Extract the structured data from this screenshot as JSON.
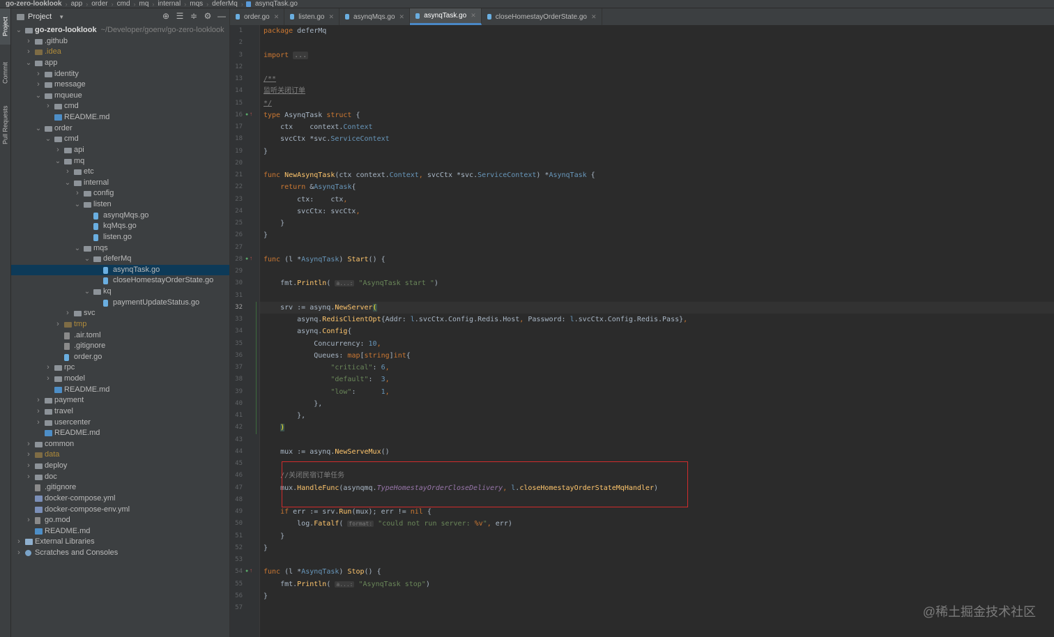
{
  "breadcrumb": [
    "go-zero-looklook",
    "app",
    "order",
    "cmd",
    "mq",
    "internal",
    "mqs",
    "deferMq",
    "asynqTask.go"
  ],
  "tool_windows": {
    "project": "Project",
    "commit": "Commit",
    "pull_requests": "Pull Requests"
  },
  "project_panel": {
    "title": "Project"
  },
  "tree": [
    {
      "depth": 0,
      "chevron": "▾",
      "icon": "folder",
      "label": "go-zero-looklook",
      "path": "~/Developer/goenv/go-zero-looklook",
      "bold": true
    },
    {
      "depth": 1,
      "chevron": "›",
      "icon": "folder",
      "label": ".github"
    },
    {
      "depth": 1,
      "chevron": "›",
      "icon": "folder-ex",
      "label": ".idea",
      "excluded": true
    },
    {
      "depth": 1,
      "chevron": "▾",
      "icon": "folder",
      "label": "app"
    },
    {
      "depth": 2,
      "chevron": "›",
      "icon": "folder",
      "label": "identity"
    },
    {
      "depth": 2,
      "chevron": "›",
      "icon": "folder",
      "label": "message"
    },
    {
      "depth": 2,
      "chevron": "▾",
      "icon": "folder",
      "label": "mqueue"
    },
    {
      "depth": 3,
      "chevron": "›",
      "icon": "folder",
      "label": "cmd"
    },
    {
      "depth": 3,
      "chevron": "",
      "icon": "md",
      "label": "README.md"
    },
    {
      "depth": 2,
      "chevron": "▾",
      "icon": "folder",
      "label": "order"
    },
    {
      "depth": 3,
      "chevron": "▾",
      "icon": "folder",
      "label": "cmd"
    },
    {
      "depth": 4,
      "chevron": "›",
      "icon": "folder",
      "label": "api"
    },
    {
      "depth": 4,
      "chevron": "▾",
      "icon": "folder",
      "label": "mq"
    },
    {
      "depth": 5,
      "chevron": "›",
      "icon": "folder",
      "label": "etc"
    },
    {
      "depth": 5,
      "chevron": "▾",
      "icon": "folder",
      "label": "internal"
    },
    {
      "depth": 6,
      "chevron": "›",
      "icon": "folder",
      "label": "config"
    },
    {
      "depth": 6,
      "chevron": "▾",
      "icon": "folder",
      "label": "listen"
    },
    {
      "depth": 7,
      "chevron": "",
      "icon": "gofile",
      "label": "asynqMqs.go"
    },
    {
      "depth": 7,
      "chevron": "",
      "icon": "gofile",
      "label": "kqMqs.go"
    },
    {
      "depth": 7,
      "chevron": "",
      "icon": "gofile",
      "label": "listen.go"
    },
    {
      "depth": 6,
      "chevron": "▾",
      "icon": "folder",
      "label": "mqs"
    },
    {
      "depth": 7,
      "chevron": "▾",
      "icon": "folder",
      "label": "deferMq"
    },
    {
      "depth": 8,
      "chevron": "",
      "icon": "gofile",
      "label": "asynqTask.go",
      "selected": true
    },
    {
      "depth": 8,
      "chevron": "",
      "icon": "gofile",
      "label": "closeHomestayOrderState.go"
    },
    {
      "depth": 7,
      "chevron": "▾",
      "icon": "folder",
      "label": "kq"
    },
    {
      "depth": 8,
      "chevron": "",
      "icon": "gofile",
      "label": "paymentUpdateStatus.go"
    },
    {
      "depth": 5,
      "chevron": "›",
      "icon": "folder",
      "label": "svc"
    },
    {
      "depth": 4,
      "chevron": "›",
      "icon": "folder-ex",
      "label": "tmp",
      "excluded": true
    },
    {
      "depth": 4,
      "chevron": "",
      "icon": "cfg",
      "label": ".air.toml"
    },
    {
      "depth": 4,
      "chevron": "",
      "icon": "cfg",
      "label": ".gitignore"
    },
    {
      "depth": 4,
      "chevron": "",
      "icon": "gofile",
      "label": "order.go"
    },
    {
      "depth": 3,
      "chevron": "›",
      "icon": "folder",
      "label": "rpc"
    },
    {
      "depth": 3,
      "chevron": "›",
      "icon": "folder",
      "label": "model"
    },
    {
      "depth": 3,
      "chevron": "",
      "icon": "md",
      "label": "README.md"
    },
    {
      "depth": 2,
      "chevron": "›",
      "icon": "folder",
      "label": "payment"
    },
    {
      "depth": 2,
      "chevron": "›",
      "icon": "folder",
      "label": "travel"
    },
    {
      "depth": 2,
      "chevron": "›",
      "icon": "folder",
      "label": "usercenter"
    },
    {
      "depth": 2,
      "chevron": "",
      "icon": "md",
      "label": "README.md"
    },
    {
      "depth": 1,
      "chevron": "›",
      "icon": "folder",
      "label": "common"
    },
    {
      "depth": 1,
      "chevron": "›",
      "icon": "folder-ex",
      "label": "data",
      "excluded": true
    },
    {
      "depth": 1,
      "chevron": "›",
      "icon": "folder",
      "label": "deploy"
    },
    {
      "depth": 1,
      "chevron": "›",
      "icon": "folder",
      "label": "doc"
    },
    {
      "depth": 1,
      "chevron": "",
      "icon": "cfg",
      "label": ".gitignore"
    },
    {
      "depth": 1,
      "chevron": "",
      "icon": "yml",
      "label": "docker-compose.yml"
    },
    {
      "depth": 1,
      "chevron": "",
      "icon": "yml",
      "label": "docker-compose-env.yml"
    },
    {
      "depth": 1,
      "chevron": "›",
      "icon": "cfg",
      "label": "go.mod"
    },
    {
      "depth": 1,
      "chevron": "",
      "icon": "md",
      "label": "README.md"
    },
    {
      "depth": 0,
      "chevron": "›",
      "icon": "lib",
      "label": "External Libraries"
    },
    {
      "depth": 0,
      "chevron": "›",
      "icon": "scratch",
      "label": "Scratches and Consoles"
    }
  ],
  "tabs": [
    {
      "label": "order.go",
      "active": false
    },
    {
      "label": "listen.go",
      "active": false
    },
    {
      "label": "asynqMqs.go",
      "active": false
    },
    {
      "label": "asynqTask.go",
      "active": true
    },
    {
      "label": "closeHomestayOrderState.go",
      "active": false
    }
  ],
  "line_numbers": [
    "1",
    "2",
    "3",
    "12",
    "13",
    "14",
    "15",
    "16",
    "17",
    "18",
    "19",
    "20",
    "21",
    "22",
    "23",
    "24",
    "25",
    "26",
    "27",
    "28",
    "29",
    "30",
    "31",
    "32",
    "33",
    "34",
    "35",
    "36",
    "37",
    "38",
    "39",
    "40",
    "41",
    "42",
    "43",
    "44",
    "45",
    "46",
    "47",
    "48",
    "49",
    "50",
    "51",
    "52",
    "53",
    "54",
    "55",
    "56",
    "57"
  ],
  "current_line": "32",
  "gutter_markers": {
    "16": "●↑",
    "28": "●↑",
    "54": "●↑"
  },
  "code": [
    [
      [
        "kw",
        "package "
      ],
      [
        "",
        "deferMq"
      ]
    ],
    [],
    [
      [
        "kw",
        "import "
      ],
      [
        "fold",
        "..."
      ]
    ],
    [],
    [
      [
        "cmu",
        "/**"
      ]
    ],
    [
      [
        "cmu",
        "监听关闭订单"
      ]
    ],
    [
      [
        "cmu",
        "*/"
      ]
    ],
    [
      [
        "kw",
        "type "
      ],
      [
        "",
        "AsynqTask "
      ],
      [
        "kw",
        "struct "
      ],
      [
        "",
        "{"
      ]
    ],
    [
      [
        "",
        "    ctx    "
      ],
      [
        "",
        "context."
      ],
      [
        "tp",
        "Context"
      ]
    ],
    [
      [
        "",
        "    svcCtx "
      ],
      [
        "",
        "*svc."
      ],
      [
        "tp",
        "ServiceContext"
      ]
    ],
    [
      [
        "",
        "}"
      ]
    ],
    [],
    [
      [
        "kw",
        "func "
      ],
      [
        "fn",
        "NewAsynqTask"
      ],
      [
        "",
        "(ctx context."
      ],
      [
        "tp",
        "Context"
      ],
      [
        "kw",
        ", "
      ],
      [
        "",
        "svcCtx *svc."
      ],
      [
        "tp",
        "ServiceContext"
      ],
      [
        "",
        ") *"
      ],
      [
        "tp",
        "AsynqTask"
      ],
      [
        "",
        " {"
      ]
    ],
    [
      [
        "",
        "    "
      ],
      [
        "kw",
        "return "
      ],
      [
        "",
        "&"
      ],
      [
        "tp",
        "AsynqTask"
      ],
      [
        "",
        "{"
      ]
    ],
    [
      [
        "",
        "        ctx:    ctx"
      ],
      [
        "kw",
        ","
      ]
    ],
    [
      [
        "",
        "        svcCtx: svcCtx"
      ],
      [
        "kw",
        ","
      ]
    ],
    [
      [
        "",
        "    }"
      ]
    ],
    [
      [
        "",
        "}"
      ]
    ],
    [],
    [
      [
        "kw",
        "func "
      ],
      [
        "",
        "(l *"
      ],
      [
        "tp",
        "AsynqTask"
      ],
      [
        "",
        ") "
      ],
      [
        "fn",
        "Start"
      ],
      [
        "",
        "() {"
      ]
    ],
    [],
    [
      [
        "",
        "    fmt."
      ],
      [
        "mt",
        "Println"
      ],
      [
        "",
        "( "
      ],
      [
        "hint",
        "a...:"
      ],
      [
        "",
        " "
      ],
      [
        "str",
        "\"AsynqTask start \""
      ],
      [
        "",
        ")"
      ]
    ],
    [],
    [
      [
        "",
        "    srv := asynq."
      ],
      [
        "mt",
        "NewServer"
      ],
      [
        "bm",
        "("
      ]
    ],
    [
      [
        "",
        "        asynq."
      ],
      [
        "mt",
        "RedisClientOpt"
      ],
      [
        "",
        "{Addr: "
      ],
      [
        "tp",
        "l"
      ],
      [
        "",
        ".svcCtx.Config.Redis.Host"
      ],
      [
        "kw",
        ", "
      ],
      [
        "",
        "Password: "
      ],
      [
        "tp",
        "l"
      ],
      [
        "",
        ".svcCtx.Config.Redis.Pass}"
      ],
      [
        "kw",
        ","
      ]
    ],
    [
      [
        "",
        "        asynq."
      ],
      [
        "mt",
        "Config"
      ],
      [
        "",
        "{"
      ]
    ],
    [
      [
        "",
        "            Concurrency: "
      ],
      [
        "num",
        "10"
      ],
      [
        "kw",
        ","
      ]
    ],
    [
      [
        "",
        "            Queues: "
      ],
      [
        "kw",
        "map"
      ],
      [
        "",
        "["
      ],
      [
        "kw",
        "string"
      ],
      [
        "",
        "]"
      ],
      [
        "kw",
        "int"
      ],
      [
        "",
        "{"
      ]
    ],
    [
      [
        "",
        "                "
      ],
      [
        "str",
        "\"critical\""
      ],
      [
        "",
        ": "
      ],
      [
        "num",
        "6"
      ],
      [
        "kw",
        ","
      ]
    ],
    [
      [
        "",
        "                "
      ],
      [
        "str",
        "\"default\""
      ],
      [
        "",
        ":  "
      ],
      [
        "num",
        "3"
      ],
      [
        "kw",
        ","
      ]
    ],
    [
      [
        "",
        "                "
      ],
      [
        "str",
        "\"low\""
      ],
      [
        "",
        ":      "
      ],
      [
        "num",
        "1"
      ],
      [
        "kw",
        ","
      ]
    ],
    [
      [
        "",
        "            },"
      ]
    ],
    [
      [
        "",
        "        },"
      ]
    ],
    [
      [
        "",
        "    "
      ],
      [
        "bm",
        ")"
      ]
    ],
    [],
    [
      [
        "",
        "    mux := asynq."
      ],
      [
        "mt",
        "NewServeMux"
      ],
      [
        "",
        "()"
      ]
    ],
    [],
    [
      [
        "",
        "    "
      ],
      [
        "cm",
        "//关闭民宿订单任务"
      ]
    ],
    [
      [
        "",
        "    mux."
      ],
      [
        "mt",
        "HandleFunc"
      ],
      [
        "",
        "(asynqmq."
      ],
      [
        "it",
        "TypeHomestayOrderCloseDelivery"
      ],
      [
        "kw",
        ", "
      ],
      [
        "tp",
        "l"
      ],
      [
        "",
        "."
      ],
      [
        "fn",
        "closeHomestayOrderStateMqHandler"
      ],
      [
        "",
        ")"
      ]
    ],
    [],
    [
      [
        "",
        "    "
      ],
      [
        "kw",
        "if "
      ],
      [
        "",
        "err := srv."
      ],
      [
        "mt",
        "Run"
      ],
      [
        "",
        "(mux); err != "
      ],
      [
        "kw",
        "nil"
      ],
      [
        "",
        " {"
      ]
    ],
    [
      [
        "",
        "        log."
      ],
      [
        "mt",
        "Fatalf"
      ],
      [
        "",
        "( "
      ],
      [
        "hint",
        "format:"
      ],
      [
        "",
        " "
      ],
      [
        "str",
        "\"could not run server: "
      ],
      [
        "kw",
        "%v"
      ],
      [
        "str",
        "\""
      ],
      [
        "kw",
        ", "
      ],
      [
        "",
        "err)"
      ]
    ],
    [
      [
        "",
        "    }"
      ]
    ],
    [
      [
        "",
        "}"
      ]
    ],
    [],
    [
      [
        "kw",
        "func "
      ],
      [
        "",
        "(l *"
      ],
      [
        "tp",
        "AsynqTask"
      ],
      [
        "",
        ") "
      ],
      [
        "fn",
        "Stop"
      ],
      [
        "",
        "() {"
      ]
    ],
    [
      [
        "",
        "    fmt."
      ],
      [
        "mt",
        "Println"
      ],
      [
        "",
        "( "
      ],
      [
        "hint",
        "a...:"
      ],
      [
        "",
        " "
      ],
      [
        "str",
        "\"AsynqTask stop\""
      ],
      [
        "",
        ")"
      ]
    ],
    [
      [
        "",
        "}"
      ]
    ],
    []
  ],
  "watermark": "@稀土掘金技术社区",
  "colors": {
    "accent": "#4a88c7",
    "selection": "#0d3a58",
    "highlight_box": "#d22c2c",
    "editor_bg": "#2b2b2b",
    "panel_bg": "#3c3f41"
  }
}
